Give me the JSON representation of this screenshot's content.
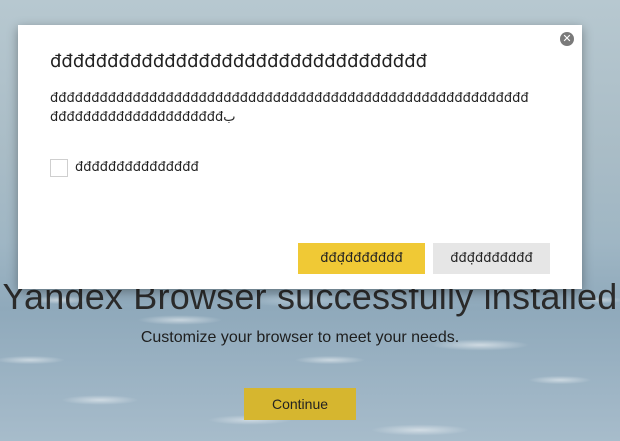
{
  "background": {
    "title": "Yandex Browser successfully installed",
    "subtitle": "Customize your browser to meet your needs.",
    "continue_label": "Continue"
  },
  "dialog": {
    "title": "đđđđđđđđđđđđđđđđđđđđđđđđđđđđđđđđđ",
    "body": "đđđđđđđđđđđđđđđđđđđđđđđđđđđđđđđđđđđđđđđđđđđđđđđđđđđđđđđđđđđđđđđđđđđđđđđđđđđđđđđب",
    "checkbox_label": "đđđđđđđđđđđđđđđ",
    "primary_button": "đđđ̣đđđđđđđ",
    "secondary_button": "đđđ̣đđđđđđđ",
    "close_glyph": "✕"
  },
  "colors": {
    "primary_button": "#f0c935",
    "secondary_button": "#e6e6e6",
    "continue_button": "#d6b62f"
  }
}
